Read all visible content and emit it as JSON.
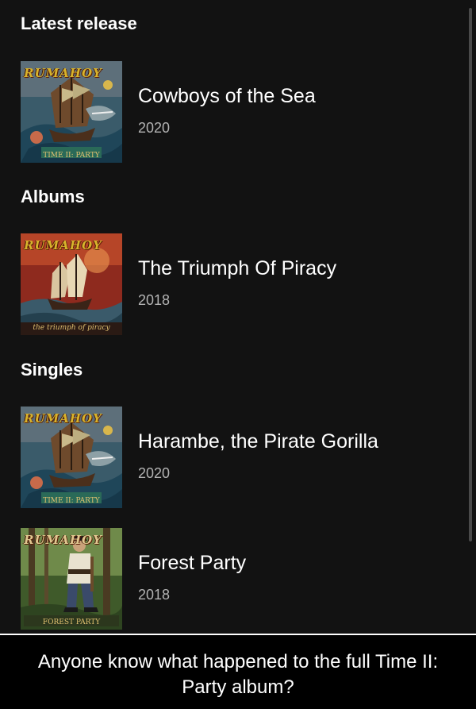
{
  "sections": {
    "latest": "Latest release",
    "albums": "Albums",
    "singles": "Singles"
  },
  "releases": [
    {
      "title": "Cowboys of the Sea",
      "year": "2020",
      "cover_band_text": "RUMAHOY",
      "cover_caption": "TIME II: PARTY",
      "cover_art": "pirate-ship-shark-cover"
    },
    {
      "title": "The Triumph Of Piracy",
      "year": "2018",
      "cover_band_text": "RUMAHOY",
      "cover_caption": "the triumph of piracy",
      "cover_art": "galleon-red-sky-cover"
    },
    {
      "title": "Harambe, the Pirate Gorilla",
      "year": "2020",
      "cover_band_text": "RUMAHOY",
      "cover_caption": "TIME II: PARTY",
      "cover_art": "pirate-ship-shark-cover"
    },
    {
      "title": "Forest Party",
      "year": "2018",
      "cover_band_text": "RUMAHOY",
      "cover_caption": "FOREST PARTY",
      "cover_art": "pirate-in-forest-cover"
    }
  ],
  "caption": "Anyone know what happened to the full Time II: Party album?",
  "colors": {
    "background": "#121212",
    "text": "#ffffff",
    "secondary_text": "#b3b3b3",
    "caption_background": "#000000"
  }
}
